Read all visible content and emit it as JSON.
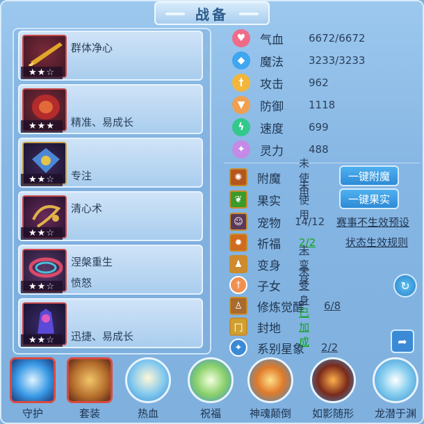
{
  "title": "战备",
  "equipment": [
    {
      "stars": 2,
      "max": 3,
      "line1": "群体净心",
      "line2": ""
    },
    {
      "stars": 3,
      "max": 3,
      "line1": "",
      "line2": "精准、易成长"
    },
    {
      "stars": 2,
      "max": 3,
      "line1": "",
      "line2": "专注"
    },
    {
      "stars": 2,
      "max": 3,
      "line1": "清心术",
      "line2": ""
    },
    {
      "stars": 2,
      "max": 3,
      "line1": "涅槃重生",
      "line2": "愤怒"
    },
    {
      "stars": 2,
      "max": 3,
      "line1": "",
      "line2": "迅捷、易成长"
    }
  ],
  "stats": [
    {
      "name": "气血",
      "value": "6672/6672",
      "icon": "heart-icon",
      "color": "#ef6b8a"
    },
    {
      "name": "魔法",
      "value": "3233/3233",
      "icon": "mana-icon",
      "color": "#3fa6ef"
    },
    {
      "name": "攻击",
      "value": "962",
      "icon": "sword-icon",
      "color": "#f3b63a"
    },
    {
      "name": "防御",
      "value": "1118",
      "icon": "shield-icon",
      "color": "#f0a050"
    },
    {
      "name": "速度",
      "value": "699",
      "icon": "lightning-icon",
      "color": "#32c98a"
    },
    {
      "name": "灵力",
      "value": "488",
      "icon": "spirit-icon",
      "color": "#c58ae6"
    }
  ],
  "features": [
    {
      "name": "附魔",
      "value": "未使用",
      "button": "一键附魔",
      "icon": "enchant-icon"
    },
    {
      "name": "果实",
      "value": "未使用",
      "button": "一键果实",
      "icon": "fruit-icon"
    },
    {
      "name": "宠物",
      "value": "14/12",
      "link": "赛事不生效预设",
      "icon": "pet-icon"
    },
    {
      "name": "祈福",
      "value": "2/2",
      "link": "状态生效规则",
      "icon": "pray-icon"
    },
    {
      "name": "变身",
      "value": "未变身",
      "icon": "transform-icon"
    },
    {
      "name": "子女",
      "value": "未变身",
      "icon": "child-icon"
    },
    {
      "name": "修炼觉醒",
      "value": "6/8",
      "icon": "cultivate-icon"
    },
    {
      "name": "封地",
      "value": "已加成",
      "icon": "fief-icon"
    },
    {
      "name": "系别星象",
      "value": "2/2",
      "icon": "star-icon"
    }
  ],
  "skills": [
    {
      "label": "守护",
      "icon": "guard-icon"
    },
    {
      "label": "套装",
      "icon": "suit-icon"
    },
    {
      "label": "热血",
      "icon": "hotblood-icon"
    },
    {
      "label": "祝福",
      "icon": "bless-icon"
    },
    {
      "label": "神魂颠倒",
      "icon": "soul-icon"
    },
    {
      "label": "如影随形",
      "icon": "shadow-icon"
    },
    {
      "label": "龙潜于渊",
      "icon": "dragon-icon"
    }
  ]
}
